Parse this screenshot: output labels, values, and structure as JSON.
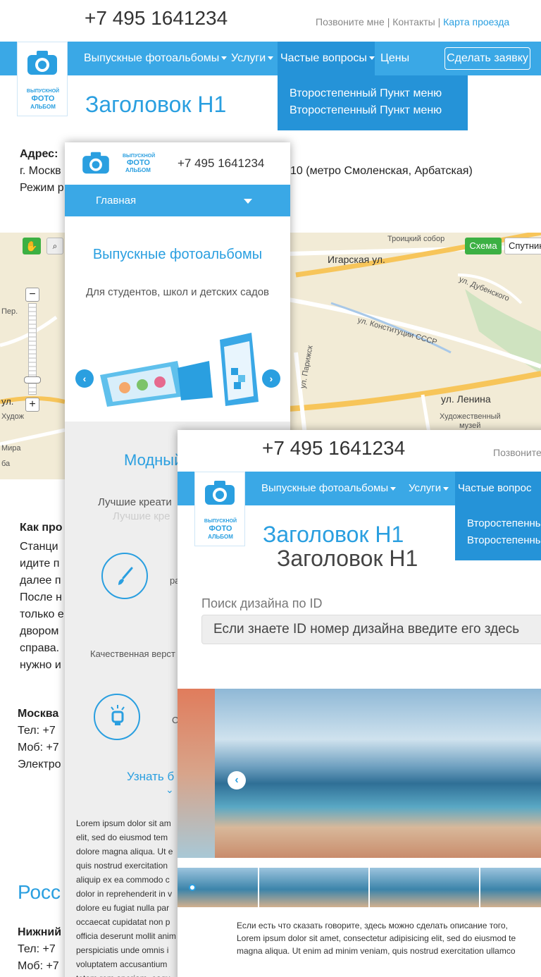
{
  "back": {
    "phone": "+7 495 1641234",
    "top_links": {
      "call_me": "Позвоните мне",
      "sep1": "|",
      "contacts": "Контакты",
      "sep2": "|",
      "map": "Карта проезда"
    },
    "nav": {
      "albums": "Выпускные фотоальбомы",
      "services": "Услуги",
      "faq": "Частые вопросы",
      "prices": "Цены",
      "order": "Сделать заявку"
    },
    "dropdown": [
      "Второстепенный Пункт меню",
      "Второстепенный Пункт меню"
    ],
    "h1": "Заголовок Н1",
    "logo": [
      "ВЫПУСКНОЙ",
      "ФОТО",
      "АЛЬБОМ"
    ],
    "address_label": "Адрес:",
    "address_line": "г. Москв",
    "address_tail": "10 (метро Смоленская, Арбатская)",
    "mode": "Режим р",
    "map": {
      "scheme": "Схема",
      "satellite": "Спутник",
      "labels": [
        "Троицкий собор",
        "Игарская ул.",
        "ул. Дубенского",
        "ул. Конституции СССР",
        "ул. Ленина",
        "Художественный",
        "музей",
        "ул. Парижск",
        "ул.",
        "Худож",
        "Мира",
        "Пер.",
        "ба"
      ]
    },
    "how": {
      "title": "Как про",
      "lines": [
        "Станци",
        "идите п",
        "далее п",
        "После н",
        "только е",
        "двором",
        "справа.",
        "нужно и"
      ]
    },
    "moscow": {
      "title": "Москва",
      "tel": "Тел: +7",
      "mob": "Моб: +7",
      "email": "Электро"
    },
    "russia": "Росс",
    "nn": {
      "title": "Нижний",
      "tel": "Тел: +7",
      "mob": "Моб: +7"
    }
  },
  "mobile": {
    "phone": "+7 495 1641234",
    "logo": [
      "ВЫПУСКНОЙ",
      "ФОТО",
      "АЛЬБОМ"
    ],
    "menu": "Главная",
    "hero_title": "Выпускные фотоальбомы",
    "hero_sub": "Для студентов, школ и детских садов",
    "section_title": "Модный",
    "best": "Лучшие креати",
    "best_ghost": "Лучшие кре",
    "side_text": "ра",
    "quality": "Качественная верст",
    "side_text2": "С",
    "more": "Узнать б",
    "lorem": "Lorem ipsum dolor sit am elit, sed do eiusmod tem dolore magna aliqua. Ut e quis nostrud exercitation aliquip ex ea commodo c dolor in reprehenderit in v dolore eu fugiat nulla par occaecat cupidatat non p officia deserunt mollit anim perspiciatis unde omnis i voluptatem accusantium totam rem aperiam, eaqu"
  },
  "front": {
    "phone": "+7 495 1641234",
    "call_me": "Позвоните",
    "logo": [
      "ВЫПУСКНОЙ",
      "ФОТО",
      "АЛЬБОМ"
    ],
    "nav": {
      "albums": "Выпускные фотоальбомы",
      "services": "Услуги",
      "faq": "Частые вопрос"
    },
    "dropdown": [
      "Второстепенный",
      "Второстепенный"
    ],
    "h1": "Заголовок Н1",
    "h1_second": "Заголовок Н1",
    "search_label": "Поиск дизайна по ID",
    "search_placeholder": "Если знаете ID номер дизайна введите его здесь",
    "desc": [
      "Если есть что сказать говорите, здесь можно сделать описание того,",
      "Lorem ipsum dolor sit amet, consectetur adipisicing elit, sed do eiusmod te",
      "magna aliqua. Ut enim ad minim veniam, quis nostrud exercitation ullamco"
    ]
  }
}
